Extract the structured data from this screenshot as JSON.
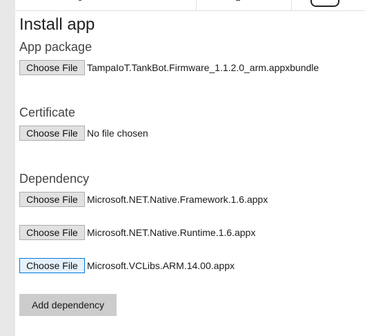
{
  "page": {
    "title": "Install app"
  },
  "sections": {
    "app_package": {
      "heading": "App package",
      "button_label": "Choose File",
      "file_name": "TampaIoT.TankBot.Firmware_1.1.2.0_arm.appxbundle"
    },
    "certificate": {
      "heading": "Certificate",
      "button_label": "Choose File",
      "file_name": "No file chosen"
    },
    "dependency": {
      "heading": "Dependency",
      "items": [
        {
          "button_label": "Choose File",
          "file_name": "Microsoft.NET.Native.Framework.1.6.appx"
        },
        {
          "button_label": "Choose File",
          "file_name": "Microsoft.NET.Native.Runtime.1.6.appx"
        },
        {
          "button_label": "Choose File",
          "file_name": "Microsoft.VCLibs.ARM.14.00.appx"
        }
      ],
      "add_button_label": "Add dependency"
    }
  },
  "colors": {
    "button_background": "#e1e1e1",
    "button_border": "#adadad",
    "focused_border": "#0078d7",
    "add_button_background": "#cccccc",
    "left_rail": "#e8e8e8"
  }
}
